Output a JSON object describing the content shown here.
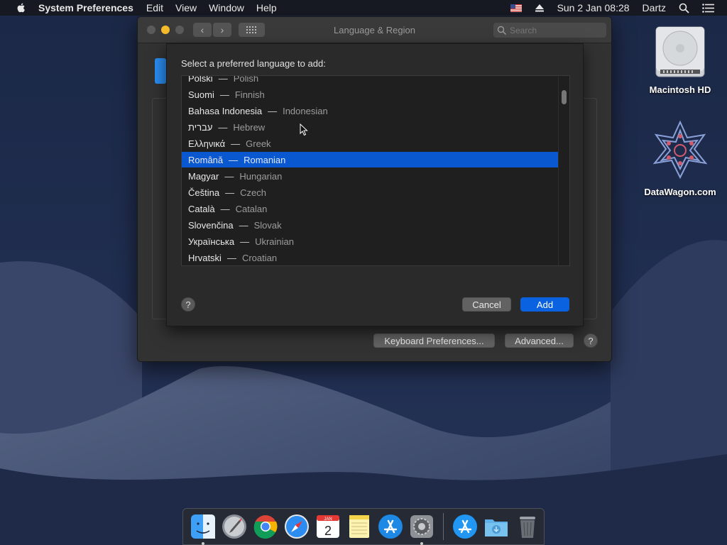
{
  "menubar": {
    "app_name": "System Preferences",
    "menus": [
      "Edit",
      "View",
      "Window",
      "Help"
    ],
    "status": {
      "date_time": "Sun 2 Jan  08:28",
      "user": "Dartz"
    }
  },
  "desktop": {
    "icons": [
      {
        "label": "Macintosh HD",
        "icon": "hard-drive-icon"
      },
      {
        "label": "DataWagon.com",
        "icon": "datawagon-logo-icon"
      }
    ]
  },
  "window": {
    "title": "Language & Region",
    "search_placeholder": "Search",
    "keyboard_prefs_label": "Keyboard Preferences...",
    "advanced_label": "Advanced...",
    "help_label": "?"
  },
  "sheet": {
    "prompt": "Select a preferred language to add:",
    "languages": [
      {
        "native": "Polski",
        "english": "Polish",
        "selected": false
      },
      {
        "native": "Suomi",
        "english": "Finnish",
        "selected": false
      },
      {
        "native": "Bahasa Indonesia",
        "english": "Indonesian",
        "selected": false
      },
      {
        "native": "עברית",
        "english": "Hebrew",
        "selected": false
      },
      {
        "native": "Ελληνικά",
        "english": "Greek",
        "selected": false
      },
      {
        "native": "Română",
        "english": "Romanian",
        "selected": true
      },
      {
        "native": "Magyar",
        "english": "Hungarian",
        "selected": false
      },
      {
        "native": "Čeština",
        "english": "Czech",
        "selected": false
      },
      {
        "native": "Català",
        "english": "Catalan",
        "selected": false
      },
      {
        "native": "Slovenčina",
        "english": "Slovak",
        "selected": false
      },
      {
        "native": "Українська",
        "english": "Ukrainian",
        "selected": false
      },
      {
        "native": "Hrvatski",
        "english": "Croatian",
        "selected": false
      }
    ],
    "dash": "—",
    "help_label": "?",
    "cancel_label": "Cancel",
    "add_label": "Add"
  },
  "dock": {
    "apps": [
      "finder-icon",
      "launchpad-icon",
      "chrome-icon",
      "safari-icon",
      "calendar-icon",
      "notes-icon",
      "app-store-icon",
      "system-preferences-icon"
    ],
    "calendar": {
      "month": "JAN",
      "day": "2"
    },
    "other": [
      "app-store-download-icon",
      "downloads-folder-icon",
      "trash-icon"
    ]
  },
  "colors": {
    "accent": "#0a62e0",
    "selection": "#0a58d0",
    "window_bg": "#323232"
  }
}
